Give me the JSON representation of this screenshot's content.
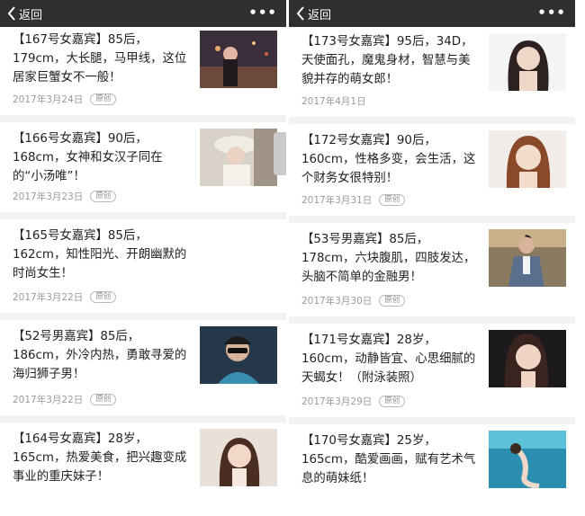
{
  "left": {
    "back_label": "返回",
    "more_label": "•••",
    "articles": [
      {
        "title": "【167号女嘉宾】85后，179cm，大长腿，马甲线，这位居家巨蟹女不一般！",
        "date": "2017年3月24日",
        "badge": "原创",
        "image": "city-night-woman-photo"
      },
      {
        "title": "【166号女嘉宾】90后，168cm，女神和女汉子同在的“小汤唯”！",
        "date": "2017年3月23日",
        "badge": "原创",
        "image": "woman-with-hat-photo"
      },
      {
        "title": "【165号女嘉宾】85后，162cm，知性阳光、开朗幽默的时尚女生！",
        "date": "2017年3月22日",
        "badge": "原创",
        "image": ""
      },
      {
        "title": "【52号男嘉宾】85后，186cm，外冷内热，勇敢寻爱的海归狮子男！",
        "date": "2017年3月22日",
        "badge": "原创",
        "image": "man-with-sunglasses-photo"
      },
      {
        "title": "【164号女嘉宾】28岁，165cm，热爱美食，把兴趣变成事业的重庆妹子！",
        "date": "",
        "badge": "",
        "image": "long-hair-woman-photo"
      }
    ]
  },
  "right": {
    "back_label": "返回",
    "more_label": "•••",
    "articles": [
      {
        "title": "【173号女嘉宾】95后，34D，天使面孔，魔鬼身材，智慧与美貌并存的萌女郎！",
        "date": "2017年4月1日",
        "badge": "",
        "image": "woman-portrait-white-bg-photo"
      },
      {
        "title": "【172号女嘉宾】90后，160cm，性格多变，会生活，这个财务女很特别！",
        "date": "2017年3月31日",
        "badge": "原创",
        "image": "woman-selfie-photo"
      },
      {
        "title": "【53号男嘉宾】85后，178cm，六块腹肌，四肢发达，头脑不简单的金融男！",
        "date": "2017年3月30日",
        "badge": "原创",
        "image": "man-in-suit-photo"
      },
      {
        "title": "【171号女嘉宾】28岁，160cm，动静皆宜、心思细腻的天蝎女！（附泳装照）",
        "date": "2017年3月29日",
        "badge": "原创",
        "image": "woman-dark-background-photo"
      },
      {
        "title": "【170号女嘉宾】25岁，165cm，酷爱画画，赋有艺术气息的萌妹纸！",
        "date": "",
        "badge": "",
        "image": "woman-underwater-photo"
      }
    ]
  },
  "colors": {
    "topbar": "#2f2f30",
    "page_bg": "#f2f2f2",
    "title_text": "#222222",
    "meta_text": "#9a9a9a"
  }
}
